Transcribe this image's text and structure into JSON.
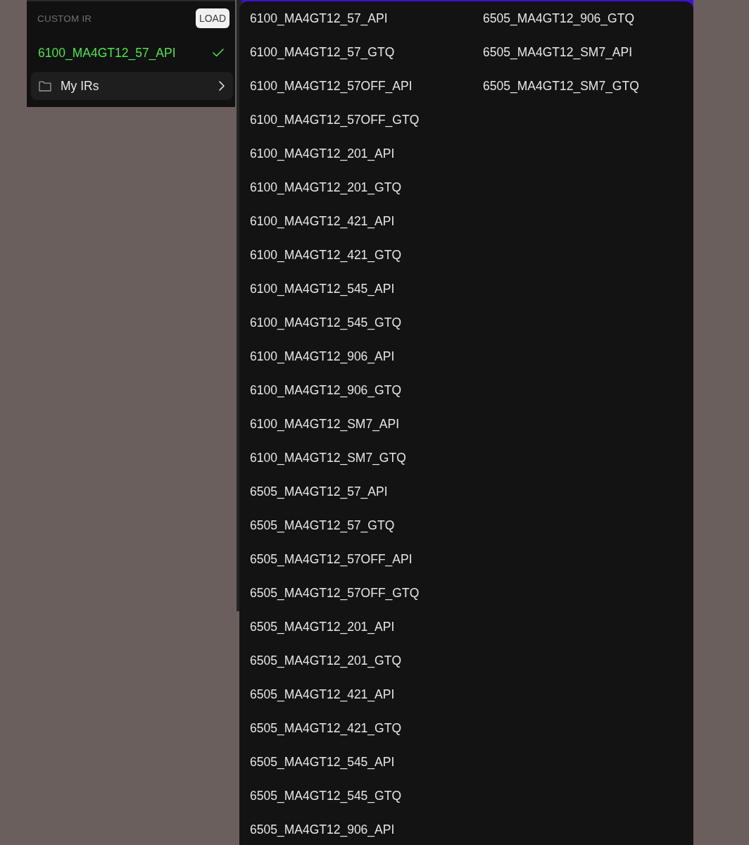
{
  "custom_ir": {
    "title": "CUSTOM IR",
    "load_button": "LOAD",
    "current": {
      "label": "6100_MA4GT12_57_API",
      "selected": true
    },
    "folder": {
      "label": "My IRs"
    }
  },
  "ir_list": {
    "items": [
      {
        "label": "6100_MA4GT12_57_API",
        "selected": false
      },
      {
        "label": "6100_MA4GT12_57_GTQ",
        "selected": false
      },
      {
        "label": "6100_MA4GT12_57OFF_API",
        "selected": false
      },
      {
        "label": "6100_MA4GT12_57OFF_GTQ",
        "selected": false
      },
      {
        "label": "6100_MA4GT12_201_API",
        "selected": false
      },
      {
        "label": "6100_MA4GT12_201_GTQ",
        "selected": false
      },
      {
        "label": "6100_MA4GT12_421_API",
        "selected": false
      },
      {
        "label": "6100_MA4GT12_421_GTQ",
        "selected": false
      },
      {
        "label": "6100_MA4GT12_545_API",
        "selected": false
      },
      {
        "label": "6100_MA4GT12_545_GTQ",
        "selected": false
      },
      {
        "label": "6100_MA4GT12_906_API",
        "selected": false
      },
      {
        "label": "6100_MA4GT12_906_GTQ",
        "selected": false
      },
      {
        "label": "6100_MA4GT12_SM7_API",
        "selected": false
      },
      {
        "label": "6100_MA4GT12_SM7_GTQ",
        "selected": false
      },
      {
        "label": "6505_MA4GT12_57_API",
        "selected": false
      },
      {
        "label": "6505_MA4GT12_57_GTQ",
        "selected": false
      },
      {
        "label": "6505_MA4GT12_57OFF_API",
        "selected": false
      },
      {
        "label": "6505_MA4GT12_57OFF_GTQ",
        "selected": false
      },
      {
        "label": "6505_MA4GT12_201_API",
        "selected": false
      },
      {
        "label": "6505_MA4GT12_201_GTQ",
        "selected": false
      },
      {
        "label": "6505_MA4GT12_421_API",
        "selected": false
      },
      {
        "label": "6505_MA4GT12_421_GTQ",
        "selected": false
      },
      {
        "label": "6505_MA4GT12_545_API",
        "selected": false
      },
      {
        "label": "6505_MA4GT12_545_GTQ",
        "selected": false
      },
      {
        "label": "6505_MA4GT12_906_API",
        "selected": false
      },
      {
        "label": "6505_MA4GT12_906_GTQ",
        "selected": false
      },
      {
        "label": "6505_MA4GT12_SM7_API",
        "selected": false
      },
      {
        "label": "6505_MA4GT12_SM7_GTQ",
        "selected": false
      }
    ]
  }
}
